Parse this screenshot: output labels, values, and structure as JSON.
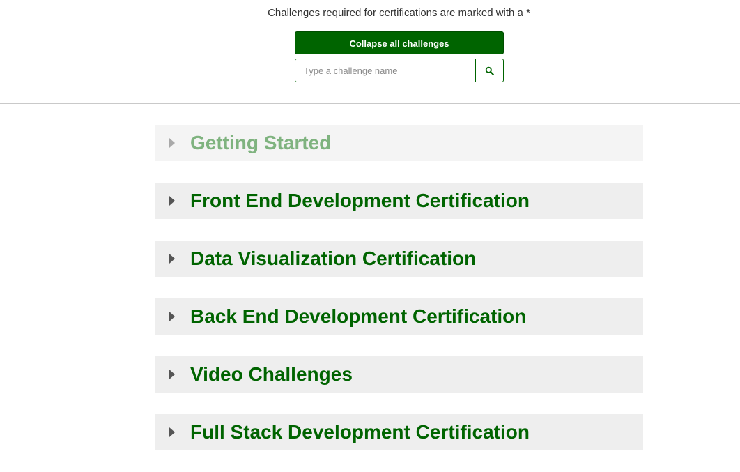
{
  "header": {
    "notice": "Challenges required for certifications are marked with a *",
    "collapse_label": "Collapse all challenges",
    "search_placeholder": "Type a challenge name"
  },
  "blocks": [
    {
      "title": "Getting Started",
      "completed": true
    },
    {
      "title": "Front End Development Certification",
      "completed": false
    },
    {
      "title": "Data Visualization Certification",
      "completed": false
    },
    {
      "title": "Back End Development Certification",
      "completed": false
    },
    {
      "title": "Video Challenges",
      "completed": false
    },
    {
      "title": "Full Stack Development Certification",
      "completed": false
    }
  ],
  "colors": {
    "accent": "#006400",
    "block_bg": "#eeeeee",
    "faded_text": "#7fb37f"
  }
}
